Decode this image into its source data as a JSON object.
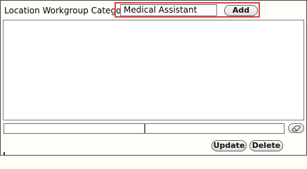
{
  "category": {
    "label": "Location Workgroup Category",
    "input_value": "Medical Assistant",
    "add_label": "Add"
  },
  "actions": {
    "update_label": "Update",
    "delete_label": "Delete"
  },
  "icons": {
    "eraser": "eraser-icon"
  },
  "colors": {
    "highlight": "#d9443f"
  }
}
